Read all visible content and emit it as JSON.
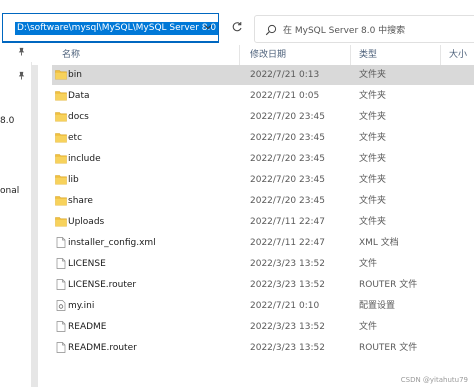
{
  "address_bar": {
    "path": "D:\\software\\mysql\\MySQL\\MySQL Server 8.0"
  },
  "search": {
    "placeholder": "在 MySQL Server 8.0 中搜索"
  },
  "nav_pane": {
    "labels": [
      "8.0",
      "onal"
    ]
  },
  "columns": {
    "name": "名称",
    "date_modified": "修改日期",
    "type": "类型",
    "size": "大小"
  },
  "files": [
    {
      "name": "bin",
      "date": "2022/7/21 0:13",
      "type": "文件夹",
      "icon": "folder-icon",
      "selected": true
    },
    {
      "name": "Data",
      "date": "2022/7/21 0:05",
      "type": "文件夹",
      "icon": "folder-icon"
    },
    {
      "name": "docs",
      "date": "2022/7/20 23:45",
      "type": "文件夹",
      "icon": "folder-icon"
    },
    {
      "name": "etc",
      "date": "2022/7/20 23:45",
      "type": "文件夹",
      "icon": "folder-icon"
    },
    {
      "name": "include",
      "date": "2022/7/20 23:45",
      "type": "文件夹",
      "icon": "folder-icon"
    },
    {
      "name": "lib",
      "date": "2022/7/20 23:45",
      "type": "文件夹",
      "icon": "folder-icon"
    },
    {
      "name": "share",
      "date": "2022/7/20 23:45",
      "type": "文件夹",
      "icon": "folder-icon"
    },
    {
      "name": "Uploads",
      "date": "2022/7/11 22:47",
      "type": "文件夹",
      "icon": "folder-icon"
    },
    {
      "name": "installer_config.xml",
      "date": "2022/7/11 22:47",
      "type": "XML 文档",
      "icon": "document-icon"
    },
    {
      "name": "LICENSE",
      "date": "2022/3/23 13:52",
      "type": "文件",
      "icon": "document-icon"
    },
    {
      "name": "LICENSE.router",
      "date": "2022/3/23 13:52",
      "type": "ROUTER 文件",
      "icon": "document-icon"
    },
    {
      "name": "my.ini",
      "date": "2022/7/21 0:10",
      "type": "配置设置",
      "icon": "settings-file-icon"
    },
    {
      "name": "README",
      "date": "2022/3/23 13:52",
      "type": "文件",
      "icon": "document-icon"
    },
    {
      "name": "README.router",
      "date": "2022/3/23 13:52",
      "type": "ROUTER 文件",
      "icon": "document-icon"
    }
  ],
  "watermark": "CSDN @yitahutu79",
  "colors": {
    "selection_bg": "#d9d9d9",
    "address_highlight": "#0078d7",
    "folder": "#f3c948"
  }
}
